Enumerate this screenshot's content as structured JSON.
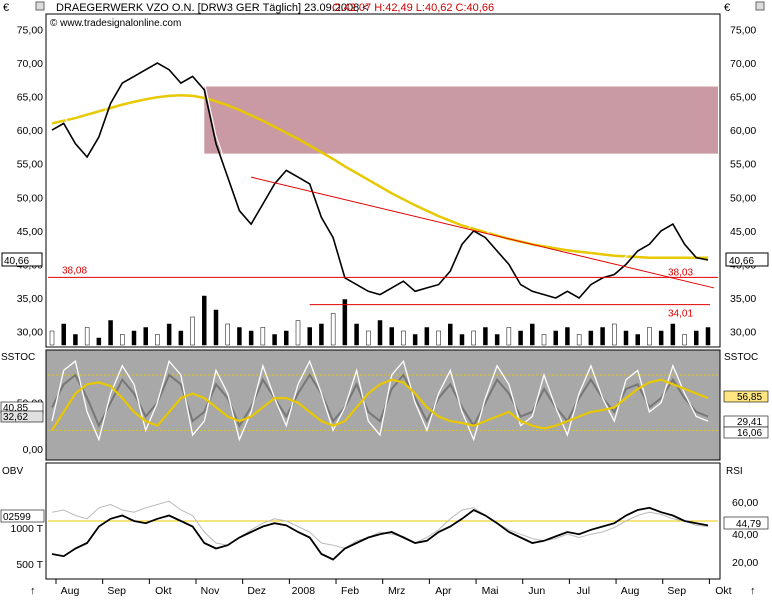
{
  "header": {
    "symbol_text": "DRAEGERWERK VZO O.N. [DRW3 GER  Täglich] 23.09.2008 <",
    "ohlc": "O:42,07 H:42,49 L:40,62 C:40,66",
    "watermark": "© www.tradesignalonline.com",
    "currency": "€"
  },
  "colors": {
    "price": "#000000",
    "sma200": "#e8c800",
    "resistance_zone": "#c99aa3",
    "support_line": "#e00000",
    "bollinger": "#555555",
    "parabolic_sar": "#e00000",
    "stoch_k": "#ffffff",
    "stoch_d": "#777777",
    "stoch_signal": "#e8c800",
    "obv": "#000000",
    "rsi": "#ffffff"
  },
  "panels": {
    "stoch_label": "SSTOC",
    "indicator_label": "OBV",
    "rsi_label": "RSI"
  },
  "chart_data": [
    {
      "type": "line",
      "panel": "price",
      "title": "DRAEGERWERK VZO O.N.",
      "ylim": [
        28,
        77
      ],
      "y_ticks_left": [
        "75,00",
        "70,00",
        "65,00",
        "60,00",
        "55,00",
        "50,00",
        "45,00",
        "40,00",
        "35,00",
        "30,00"
      ],
      "y_ticks_right": [
        "75,00",
        "70,00",
        "65,00",
        "60,00",
        "55,00",
        "50,00",
        "45,00",
        "40,00",
        "35,00",
        "30,00"
      ],
      "last_price_label": "40,66",
      "levels": [
        {
          "label": "38,08",
          "value": 38.08
        },
        {
          "label": "38,03",
          "value": 38.03
        },
        {
          "label": "34,01",
          "value": 34.01
        }
      ],
      "resistance_zone": [
        56.5,
        66.5
      ],
      "x_months": [
        "Aug",
        "Sep",
        "Okt",
        "Nov",
        "Dez",
        "2008",
        "Feb",
        "Mrz",
        "Apr",
        "Mai",
        "Jun",
        "Jul",
        "Aug",
        "Sep",
        "Okt"
      ],
      "series": [
        {
          "values": [
            60,
            61,
            58,
            56,
            59,
            64,
            67,
            68,
            69,
            70,
            69,
            67,
            68,
            66,
            58,
            53,
            48,
            46,
            49,
            52,
            54,
            53,
            52,
            47,
            44,
            38,
            37,
            36,
            35.5,
            36.5,
            37.5,
            36,
            36.5,
            37,
            39,
            43,
            45,
            44,
            42,
            40,
            37,
            36,
            35.5,
            35,
            36,
            35,
            37,
            38,
            38.5,
            40,
            42,
            43,
            45,
            46,
            43,
            41,
            40.66
          ]
        },
        {
          "values": [
            61,
            61.4,
            61.8,
            62.3,
            62.8,
            63.3,
            63.8,
            64.2,
            64.6,
            64.9,
            65.1,
            65.2,
            65.1,
            64.8,
            64.3,
            63.7,
            63,
            62.2,
            61.4,
            60.5,
            59.6,
            58.7,
            57.7,
            56.7,
            55.7,
            54.6,
            53.6,
            52.6,
            51.6,
            50.6,
            49.7,
            48.8,
            48,
            47.2,
            46.5,
            45.8,
            45.3,
            44.8,
            44.3,
            43.8,
            43.4,
            43,
            42.7,
            42.4,
            42.1,
            41.9,
            41.7,
            41.5,
            41.3,
            41.2,
            41.1,
            41,
            41,
            41,
            41,
            41,
            41
          ]
        }
      ],
      "volume": [
        4,
        6,
        3,
        5,
        2,
        7,
        3,
        4,
        5,
        3,
        6,
        4,
        8,
        14,
        10,
        6,
        5,
        4,
        5,
        3,
        4,
        7,
        5,
        6,
        9,
        13,
        6,
        4,
        7,
        5,
        4,
        3,
        5,
        4,
        6,
        3,
        4,
        5,
        3,
        5,
        4,
        6,
        3,
        4,
        5,
        3,
        4,
        5,
        6,
        4,
        3,
        5,
        4,
        6,
        3,
        4,
        5
      ]
    },
    {
      "type": "line",
      "panel": "stochastic",
      "ylim": [
        -10,
        105
      ],
      "y_ticks_left": [
        "50,00",
        "0,00"
      ],
      "left_value_labels": [
        "40,85",
        "32,62"
      ],
      "right_value_labels": [
        "56,85",
        "29,41",
        "16,06"
      ],
      "hlines": [
        80,
        20
      ],
      "series": [
        {
          "values": [
            30,
            85,
            95,
            40,
            10,
            60,
            90,
            70,
            20,
            50,
            95,
            80,
            15,
            30,
            85,
            60,
            10,
            40,
            90,
            55,
            25,
            70,
            95,
            60,
            20,
            45,
            85,
            30,
            15,
            80,
            95,
            50,
            20,
            60,
            85,
            40,
            10,
            55,
            90,
            70,
            25,
            35,
            80,
            45,
            15,
            60,
            90,
            55,
            30,
            75,
            85,
            40,
            50,
            90,
            60,
            35,
            30
          ]
        },
        {
          "values": [
            45,
            70,
            80,
            55,
            25,
            50,
            75,
            60,
            35,
            50,
            80,
            70,
            30,
            40,
            70,
            55,
            25,
            45,
            75,
            55,
            35,
            60,
            80,
            60,
            30,
            45,
            70,
            40,
            30,
            65,
            80,
            55,
            30,
            55,
            70,
            45,
            25,
            50,
            75,
            60,
            35,
            40,
            65,
            45,
            30,
            55,
            75,
            55,
            40,
            65,
            70,
            45,
            55,
            75,
            55,
            40,
            35
          ]
        },
        {
          "values": [
            20,
            40,
            60,
            70,
            72,
            68,
            55,
            40,
            30,
            25,
            40,
            55,
            60,
            55,
            45,
            35,
            30,
            35,
            45,
            55,
            55,
            50,
            40,
            30,
            25,
            30,
            45,
            60,
            70,
            75,
            72,
            60,
            45,
            35,
            30,
            28,
            25,
            30,
            35,
            40,
            30,
            25,
            22,
            25,
            30,
            35,
            40,
            42,
            45,
            55,
            65,
            72,
            75,
            70,
            65,
            60,
            55
          ]
        }
      ]
    },
    {
      "type": "line",
      "panel": "obv_rsi",
      "y_ticks_left": [
        "1000 T",
        "500 T"
      ],
      "y_ticks_right": [
        "60,00",
        "40,00",
        "20,00"
      ],
      "left_value_label": "02599",
      "right_value_label": "44,79",
      "series": [
        {
          "values": [
            20,
            18,
            25,
            30,
            45,
            52,
            55,
            50,
            48,
            52,
            55,
            50,
            45,
            30,
            25,
            28,
            35,
            40,
            45,
            48,
            46,
            40,
            35,
            20,
            15,
            25,
            30,
            35,
            38,
            40,
            35,
            30,
            32,
            40,
            45,
            52,
            60,
            55,
            48,
            40,
            35,
            30,
            32,
            36,
            40,
            38,
            42,
            45,
            48,
            55,
            60,
            62,
            58,
            55,
            50,
            48,
            46
          ]
        },
        {
          "values": [
            58,
            60,
            55,
            52,
            62,
            65,
            60,
            58,
            62,
            65,
            68,
            60,
            55,
            40,
            30,
            28,
            35,
            42,
            48,
            52,
            50,
            45,
            40,
            30,
            28,
            25,
            32,
            35,
            40,
            38,
            36,
            30,
            35,
            42,
            52,
            60,
            62,
            55,
            48,
            42,
            38,
            34,
            32,
            34,
            38,
            35,
            38,
            40,
            44,
            50,
            55,
            58,
            56,
            52,
            50,
            46,
            45
          ]
        }
      ]
    }
  ]
}
